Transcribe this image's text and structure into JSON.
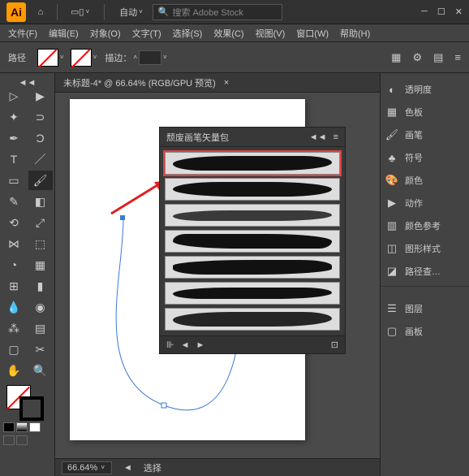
{
  "app": {
    "logo": "Ai"
  },
  "top": {
    "auto_label": "自动",
    "search_placeholder": "搜索 Adobe Stock"
  },
  "menu": {
    "items": [
      "文件(F)",
      "编辑(E)",
      "对象(O)",
      "文字(T)",
      "选择(S)",
      "效果(C)",
      "视图(V)",
      "窗口(W)",
      "帮助(H)"
    ]
  },
  "ctl": {
    "left_label": "路径",
    "stroke_label": "描边：",
    "stroke_value": ""
  },
  "doc": {
    "tab": "未标题-4* @ 66.64% (RGB/GPU 预览)"
  },
  "brush_panel": {
    "title": "颓废画笔矢量包",
    "nav_prev": "◄",
    "nav_next": "►",
    "lib": "⊪"
  },
  "status": {
    "zoom": "66.64%",
    "select_label": "选择"
  },
  "right": {
    "items": [
      "透明度",
      "色板",
      "画笔",
      "符号",
      "颜色",
      "动作",
      "颜色参考",
      "图形样式",
      "路径查…"
    ],
    "items2": [
      "图层",
      "画板"
    ]
  },
  "chart_data": null
}
